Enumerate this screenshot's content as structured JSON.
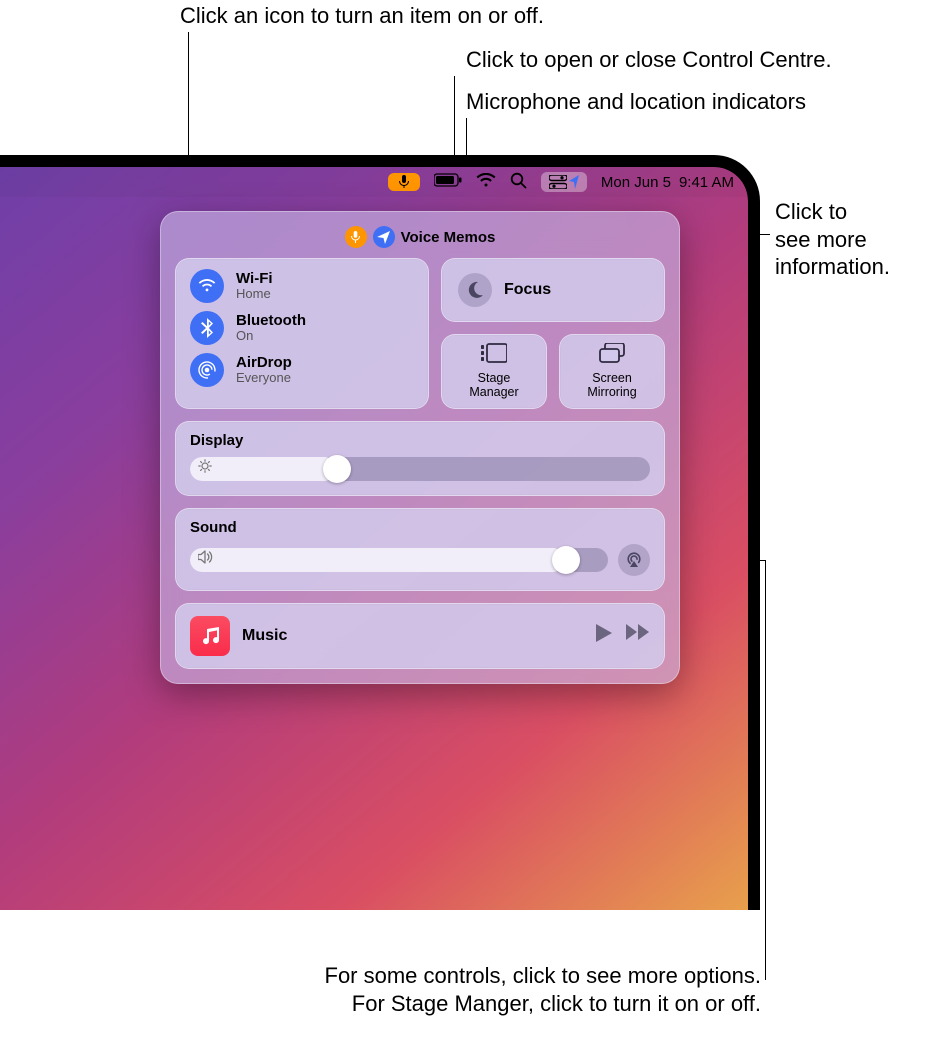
{
  "callouts": {
    "toggle_onoff": "Click an icon to turn an item on or off.",
    "open_close_cc": "Click to open or close Control Centre.",
    "indicators": "Microphone and location indicators",
    "see_info": "Click to\nsee more\ninformation.",
    "more_options_l1": "For some controls, click to see more options.",
    "more_options_l2": "For Stage Manger, click to turn it on or off."
  },
  "menubar": {
    "date": "Mon Jun 5",
    "time": "9:41 AM"
  },
  "indicator": {
    "app": "Voice Memos"
  },
  "network": {
    "wifi": {
      "title": "Wi-Fi",
      "sub": "Home"
    },
    "bluetooth": {
      "title": "Bluetooth",
      "sub": "On"
    },
    "airdrop": {
      "title": "AirDrop",
      "sub": "Everyone"
    }
  },
  "focus": {
    "label": "Focus"
  },
  "small": {
    "stage": "Stage\nManager",
    "mirror": "Screen\nMirroring"
  },
  "display": {
    "label": "Display",
    "value_pct": 32
  },
  "sound": {
    "label": "Sound",
    "value_pct": 90
  },
  "music": {
    "title": "Music"
  }
}
